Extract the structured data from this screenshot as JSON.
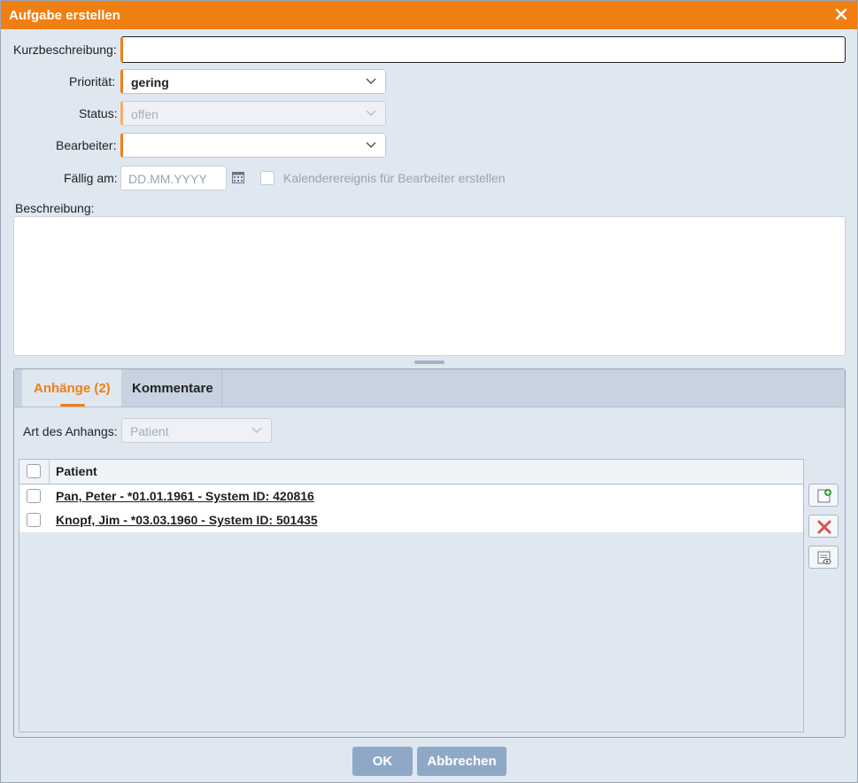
{
  "window": {
    "title": "Aufgabe erstellen",
    "close_icon": "close-icon"
  },
  "colors": {
    "accent": "#f07f12",
    "background": "#dfe7f1",
    "button": "#8fa8c6",
    "delete": "#d9534f"
  },
  "form": {
    "kurzbeschreibung_label": "Kurzbeschreibung:",
    "kurzbeschreibung_value": "",
    "prioritaet_label": "Priorität:",
    "prioritaet_value": "gering",
    "status_label": "Status:",
    "status_value": "offen",
    "bearbeiter_label": "Bearbeiter:",
    "bearbeiter_value": "",
    "faellig_label": "Fällig am:",
    "faellig_placeholder": "DD.MM.YYYY",
    "kalender_checkbox_label": "Kalenderereignis für Bearbeiter erstellen",
    "kalender_checked": false,
    "beschreibung_label": "Beschreibung:",
    "beschreibung_value": ""
  },
  "tabs": [
    {
      "label": "Anhänge (2)",
      "active": true
    },
    {
      "label": "Kommentare",
      "active": false
    }
  ],
  "attachments": {
    "type_label": "Art des Anhangs:",
    "type_value": "Patient",
    "column_header": "Patient",
    "rows": [
      {
        "text": "Pan, Peter - *01.01.1961 - System ID: 420816",
        "checked": false
      },
      {
        "text": "Knopf, Jim - *03.03.1960 - System ID: 501435",
        "checked": false
      }
    ],
    "side_buttons": [
      "add-document-icon",
      "delete-icon",
      "preview-icon"
    ]
  },
  "footer": {
    "ok_label": "OK",
    "cancel_label": "Abbrechen"
  }
}
